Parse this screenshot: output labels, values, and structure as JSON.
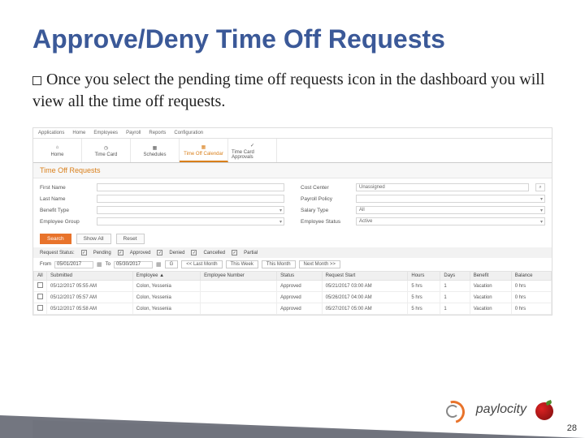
{
  "title": "Approve/Deny Time Off Requests",
  "body_text": "Once you select the pending time off requests icon in the dashboard you will view all the time off requests.",
  "top_menu": [
    "Applications",
    "Home",
    "Employees",
    "Payroll",
    "Reports",
    "Configuration"
  ],
  "tabs": [
    {
      "label": "Home"
    },
    {
      "label": "Time Card"
    },
    {
      "label": "Schedules"
    },
    {
      "label": "Time Off Calendar"
    },
    {
      "label": "Time Card Approvals"
    }
  ],
  "section_title": "Time Off Requests",
  "filters_left": [
    {
      "label": "First Name",
      "value": ""
    },
    {
      "label": "Last Name",
      "value": ""
    },
    {
      "label": "Benefit Type",
      "value": "",
      "dropdown": true
    },
    {
      "label": "Employee Group",
      "value": "",
      "dropdown": true
    }
  ],
  "filters_right": [
    {
      "label": "Cost Center",
      "value": "Unassigned",
      "search": true
    },
    {
      "label": "Payroll Policy",
      "value": "",
      "dropdown": true
    },
    {
      "label": "Salary Type",
      "value": "All",
      "dropdown": true
    },
    {
      "label": "Employee Status",
      "value": "Active",
      "dropdown": true
    }
  ],
  "buttons": {
    "search": "Search",
    "showall": "Show All",
    "reset": "Reset"
  },
  "status_label": "Request Status:",
  "statuses": [
    {
      "label": "Pending",
      "checked": true
    },
    {
      "label": "Approved",
      "checked": true
    },
    {
      "label": "Denied",
      "checked": true
    },
    {
      "label": "Cancelled",
      "checked": true
    },
    {
      "label": "Partial",
      "checked": true
    }
  ],
  "date_bar": {
    "from_label": "From",
    "from": "05/01/2017",
    "to_label": "To",
    "to": "05/30/2017",
    "go": "G",
    "last_month": "<< Last Month",
    "this_week": "This Week",
    "this_month": "This Month",
    "next_month": "Next Month >>"
  },
  "headers": [
    "All",
    "Submitted",
    "Employee ▲",
    "Employee Number",
    "Status",
    "Request Start",
    "Hours",
    "Days",
    "Benefit",
    "Balance"
  ],
  "rows": [
    {
      "submitted": "05/12/2017 05:55 AM",
      "employee": "Colon, Yessenia",
      "empno": "",
      "status": "Approved",
      "start": "05/21/2017 03:00 AM",
      "hours": "5 hrs",
      "days": "1",
      "benefit": "Vacation",
      "balance": "0 hrs"
    },
    {
      "submitted": "05/12/2017 05:57 AM",
      "employee": "Colon, Yessenia",
      "empno": "",
      "status": "Approved",
      "start": "05/26/2017 04:00 AM",
      "hours": "5 hrs",
      "days": "1",
      "benefit": "Vacation",
      "balance": "0 hrs"
    },
    {
      "submitted": "05/12/2017 05:58 AM",
      "employee": "Colon, Yessenia",
      "empno": "",
      "status": "Approved",
      "start": "05/27/2017 05:00 AM",
      "hours": "5 hrs",
      "days": "1",
      "benefit": "Vacation",
      "balance": "0 hrs"
    }
  ],
  "logo_text": "paylocity",
  "page_number": "28"
}
